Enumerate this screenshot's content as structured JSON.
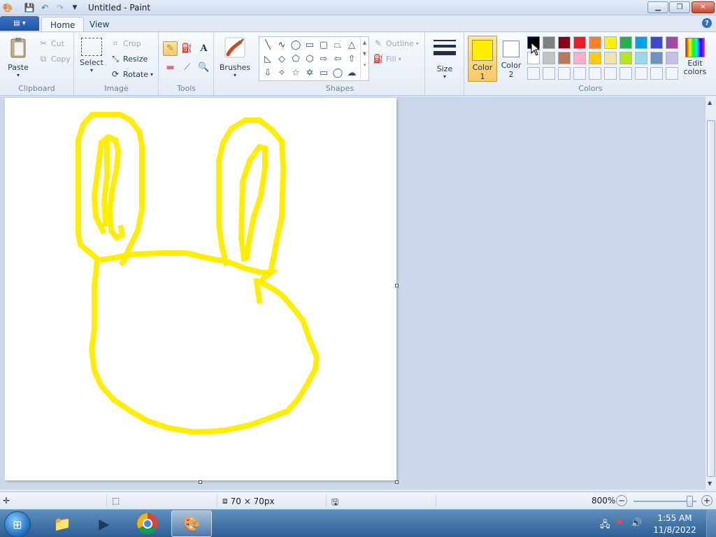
{
  "window": {
    "title": "Untitled - Paint",
    "minimize_icon": "minimize-icon",
    "maximize_icon": "restore-icon",
    "close_icon": "close-icon"
  },
  "tabs": [
    {
      "label": "Home",
      "active": true
    },
    {
      "label": "View",
      "active": false
    }
  ],
  "ribbon": {
    "clipboard": {
      "label": "Clipboard",
      "paste": "Paste",
      "cut": "Cut",
      "copy": "Copy"
    },
    "image": {
      "label": "Image",
      "select": "Select",
      "crop": "Crop",
      "resize": "Resize",
      "rotate": "Rotate"
    },
    "tools": {
      "label": "Tools",
      "active_tool": "pencil"
    },
    "brushes": {
      "label": "Brushes"
    },
    "shapes": {
      "label": "Shapes",
      "outline": "Outline",
      "fill": "Fill"
    },
    "size": {
      "label": "Size"
    },
    "colors": {
      "label": "Colors",
      "color1_label": "Color",
      "color1_num": "1",
      "color2_label": "Color",
      "color2_num": "2",
      "edit_colors": "Edit colors",
      "color1_value": "#ffee00",
      "color2_value": "#ffffff",
      "palette_row1": [
        "#000000",
        "#7f7f7f",
        "#880015",
        "#ed1c24",
        "#ff7f27",
        "#fff200",
        "#22b14c",
        "#00a2e8",
        "#3f48cc",
        "#a349a4"
      ],
      "palette_row2": [
        "#ffffff",
        "#c3c3c3",
        "#b97a57",
        "#ffaec9",
        "#ffc90e",
        "#efe4b0",
        "#b5e61d",
        "#99d9ea",
        "#7092be",
        "#c8bfe7"
      ]
    }
  },
  "canvas": {
    "stroke_color": "#ffee00",
    "background": "#ffffff"
  },
  "status": {
    "image_size": "70 × 70px",
    "zoom": "800%"
  },
  "taskbar": {
    "time": "1:55 AM",
    "date": "11/8/2022"
  }
}
